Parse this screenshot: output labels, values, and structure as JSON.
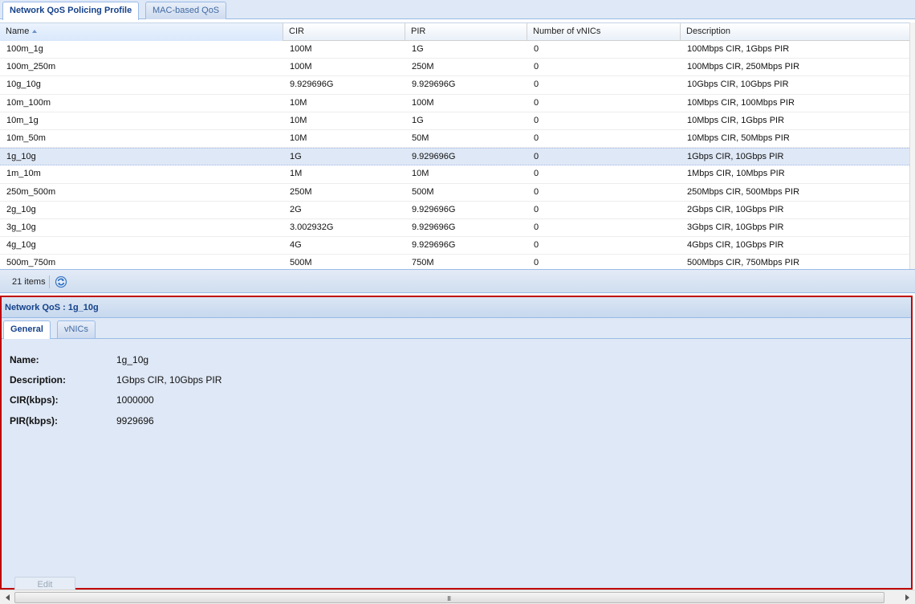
{
  "top_tabs": [
    {
      "label": "Network QoS Policing Profile",
      "active": true
    },
    {
      "label": "MAC-based QoS",
      "active": false
    }
  ],
  "grid": {
    "columns": [
      "Name",
      "CIR",
      "PIR",
      "Number of vNICs",
      "Description"
    ],
    "sorted_column": "Name",
    "sort_direction": "ascending",
    "rows": [
      [
        "100m_1g",
        "100M",
        "1G",
        "0",
        "100Mbps CIR, 1Gbps PIR"
      ],
      [
        "100m_250m",
        "100M",
        "250M",
        "0",
        "100Mbps CIR, 250Mbps PIR"
      ],
      [
        "10g_10g",
        "9.929696G",
        "9.929696G",
        "0",
        "10Gbps CIR, 10Gbps PIR"
      ],
      [
        "10m_100m",
        "10M",
        "100M",
        "0",
        "10Mbps CIR, 100Mbps PIR"
      ],
      [
        "10m_1g",
        "10M",
        "1G",
        "0",
        "10Mbps CIR, 1Gbps PIR"
      ],
      [
        "10m_50m",
        "10M",
        "50M",
        "0",
        "10Mbps CIR, 50Mbps PIR"
      ],
      [
        "1g_10g",
        "1G",
        "9.929696G",
        "0",
        "1Gbps CIR, 10Gbps PIR"
      ],
      [
        "1m_10m",
        "1M",
        "10M",
        "0",
        "1Mbps CIR, 10Mbps PIR"
      ],
      [
        "250m_500m",
        "250M",
        "500M",
        "0",
        "250Mbps CIR, 500Mbps PIR"
      ],
      [
        "2g_10g",
        "2G",
        "9.929696G",
        "0",
        "2Gbps CIR, 10Gbps PIR"
      ],
      [
        "3g_10g",
        "3.002932G",
        "9.929696G",
        "0",
        "3Gbps CIR, 10Gbps PIR"
      ],
      [
        "4g_10g",
        "4G",
        "9.929696G",
        "0",
        "4Gbps CIR, 10Gbps PIR"
      ],
      [
        "500m_750m",
        "500M",
        "750M",
        "0",
        "500Mbps CIR, 750Mbps PIR"
      ]
    ],
    "selected_row": "1g_10g"
  },
  "pager": {
    "items_count": "21 items",
    "refresh_icon": "refresh-icon"
  },
  "detail": {
    "title": "Network QoS : 1g_10g",
    "tabs": [
      {
        "label": "General",
        "active": true
      },
      {
        "label": "vNICs",
        "active": false
      }
    ],
    "fields": [
      {
        "label": "Name:",
        "value": "1g_10g"
      },
      {
        "label": "Description:",
        "value": "1Gbps CIR, 10Gbps PIR"
      },
      {
        "label": "CIR(kbps):",
        "value": "1000000"
      },
      {
        "label": "PIR(kbps):",
        "value": "9929696"
      }
    ],
    "edit_label": "Edit"
  },
  "scrollbar": {
    "grip": "III"
  },
  "colors": {
    "accent_border": "#c00000",
    "panel_bg": "#dfe8f6",
    "title_text": "#15428b"
  }
}
